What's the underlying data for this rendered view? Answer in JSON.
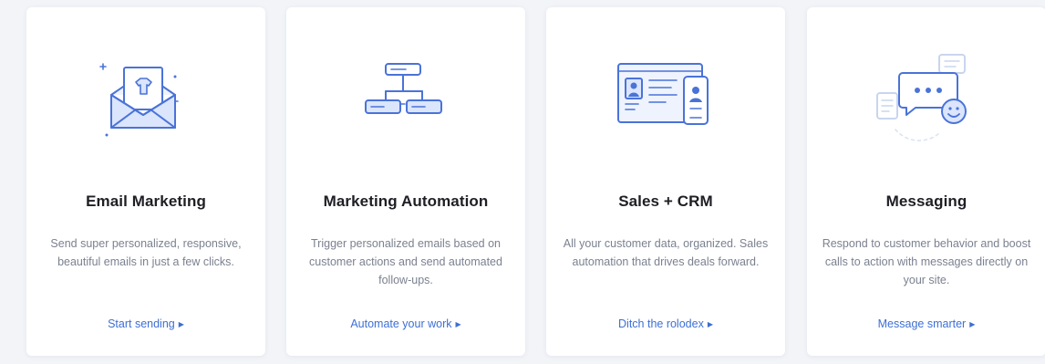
{
  "colors": {
    "accent": "#3d6fd4",
    "icon_stroke": "#4a73d8",
    "icon_fill": "#dbe5fb",
    "title": "#1e1e24",
    "description": "#7b8190",
    "background": "#f2f4f8"
  },
  "cards": [
    {
      "icon": "envelope-shirt-icon",
      "title": "Email Marketing",
      "description": "Send super personalized, responsive, beautiful emails in just a few clicks.",
      "cta": "Start sending"
    },
    {
      "icon": "flowchart-icon",
      "title": "Marketing Automation",
      "description": "Trigger personalized emails based on customer actions and send automated follow-ups.",
      "cta": "Automate your work"
    },
    {
      "icon": "contact-card-phone-icon",
      "title": "Sales + CRM",
      "description": "All your customer data, organized. Sales automation that drives deals forward.",
      "cta": "Ditch the rolodex"
    },
    {
      "icon": "chat-bubbles-icon",
      "title": "Messaging",
      "description": "Respond to customer behavior and boost calls to action with messages directly on your site.",
      "cta": "Message smarter"
    }
  ]
}
